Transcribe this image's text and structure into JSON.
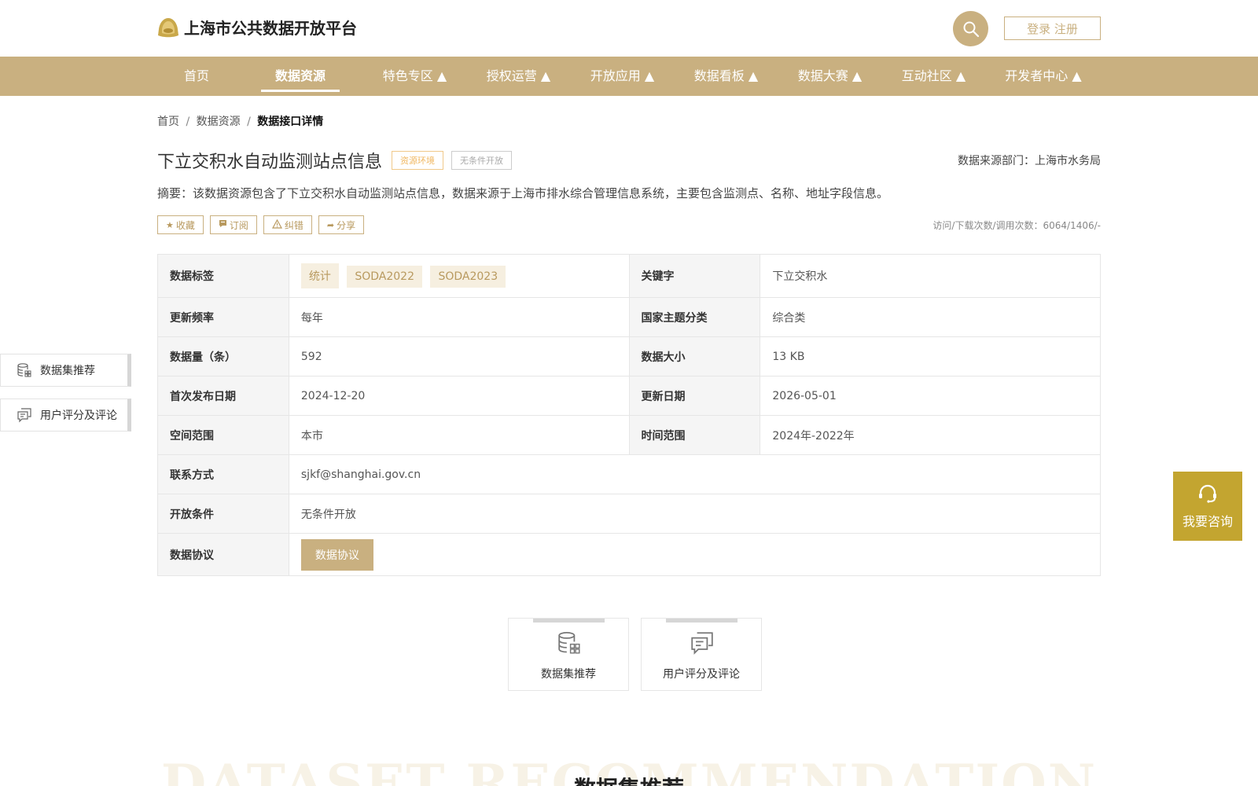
{
  "header": {
    "site_title": "上海市公共数据开放平台",
    "login_label": "登录 注册"
  },
  "nav": {
    "items": [
      {
        "label": "首页"
      },
      {
        "label": "数据资源"
      },
      {
        "label": "特色专区 ▲"
      },
      {
        "label": "授权运营 ▲"
      },
      {
        "label": "开放应用 ▲"
      },
      {
        "label": "数据看板 ▲"
      },
      {
        "label": "数据大赛 ▲"
      },
      {
        "label": "互动社区 ▲"
      },
      {
        "label": "开发者中心 ▲"
      }
    ],
    "active_index": 1
  },
  "breadcrumb": {
    "home": "首页",
    "section": "数据资源",
    "current": "数据接口详情",
    "separator": "/"
  },
  "dataset": {
    "title": "下立交积水自动监测站点信息",
    "tag_category": "资源环境",
    "tag_open": "无条件开放",
    "source_dept": "数据来源部门：上海市水务局",
    "summary": "摘要：该数据资源包含了下立交积水自动监测站点信息，数据来源于上海市排水综合管理信息系统，主要包含监测点、名称、地址字段信息。",
    "counts": "访问/下载次数/调用次数：6064/1406/-"
  },
  "actions": {
    "favorite": "收藏",
    "subscribe": "订阅",
    "report": "纠错",
    "share": "分享"
  },
  "info": {
    "tags_label": "数据标签",
    "tags": [
      "统计",
      "SODA2022",
      "SODA2023"
    ],
    "keyword_label": "关键字",
    "keyword": "下立交积水",
    "freq_label": "更新频率",
    "freq": "每年",
    "theme_label": "国家主题分类",
    "theme": "综合类",
    "count_label": "数据量（条）",
    "count": "592",
    "size_label": "数据大小",
    "size": "13 KB",
    "first_pub_label": "首次发布日期",
    "first_pub": "2024-12-20",
    "update_label": "更新日期",
    "update": "2026-05-01",
    "space_label": "空间范围",
    "space": "本市",
    "time_label": "时间范围",
    "time": "2024年-2022年",
    "contact_label": "联系方式",
    "contact": "sjkf@shanghai.gov.cn",
    "open_cond_label": "开放条件",
    "open_cond": "无条件开放",
    "protocol_label": "数据协议",
    "protocol_button": "数据协议"
  },
  "side_tabs": {
    "recommend": "数据集推荐",
    "comments": "用户评分及评论"
  },
  "consult": {
    "label": "我要咨询"
  },
  "bottom_tabs": {
    "recommend": "数据集推荐",
    "comments": "用户评分及评论"
  },
  "section": {
    "bg_text": "DATASET RECOMMENDATION",
    "title": "数据集推荐"
  },
  "colors": {
    "brand": "#c9b080",
    "consult": "#c3a530",
    "tag_bg": "#f6efe0"
  }
}
